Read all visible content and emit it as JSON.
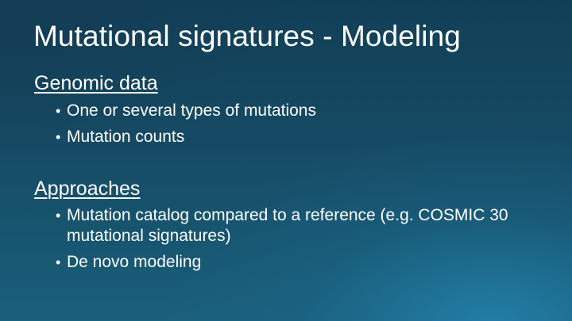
{
  "title": "Mutational signatures - Modeling",
  "sections": [
    {
      "heading": "Genomic data",
      "bullets": [
        "One or several types of mutations",
        "Mutation counts"
      ]
    },
    {
      "heading": "Approaches",
      "bullets": [
        "Mutation catalog compared to a reference (e.g. COSMIC 30 mutational signatures)",
        "De novo modeling"
      ]
    }
  ],
  "bullet_glyph": "•"
}
